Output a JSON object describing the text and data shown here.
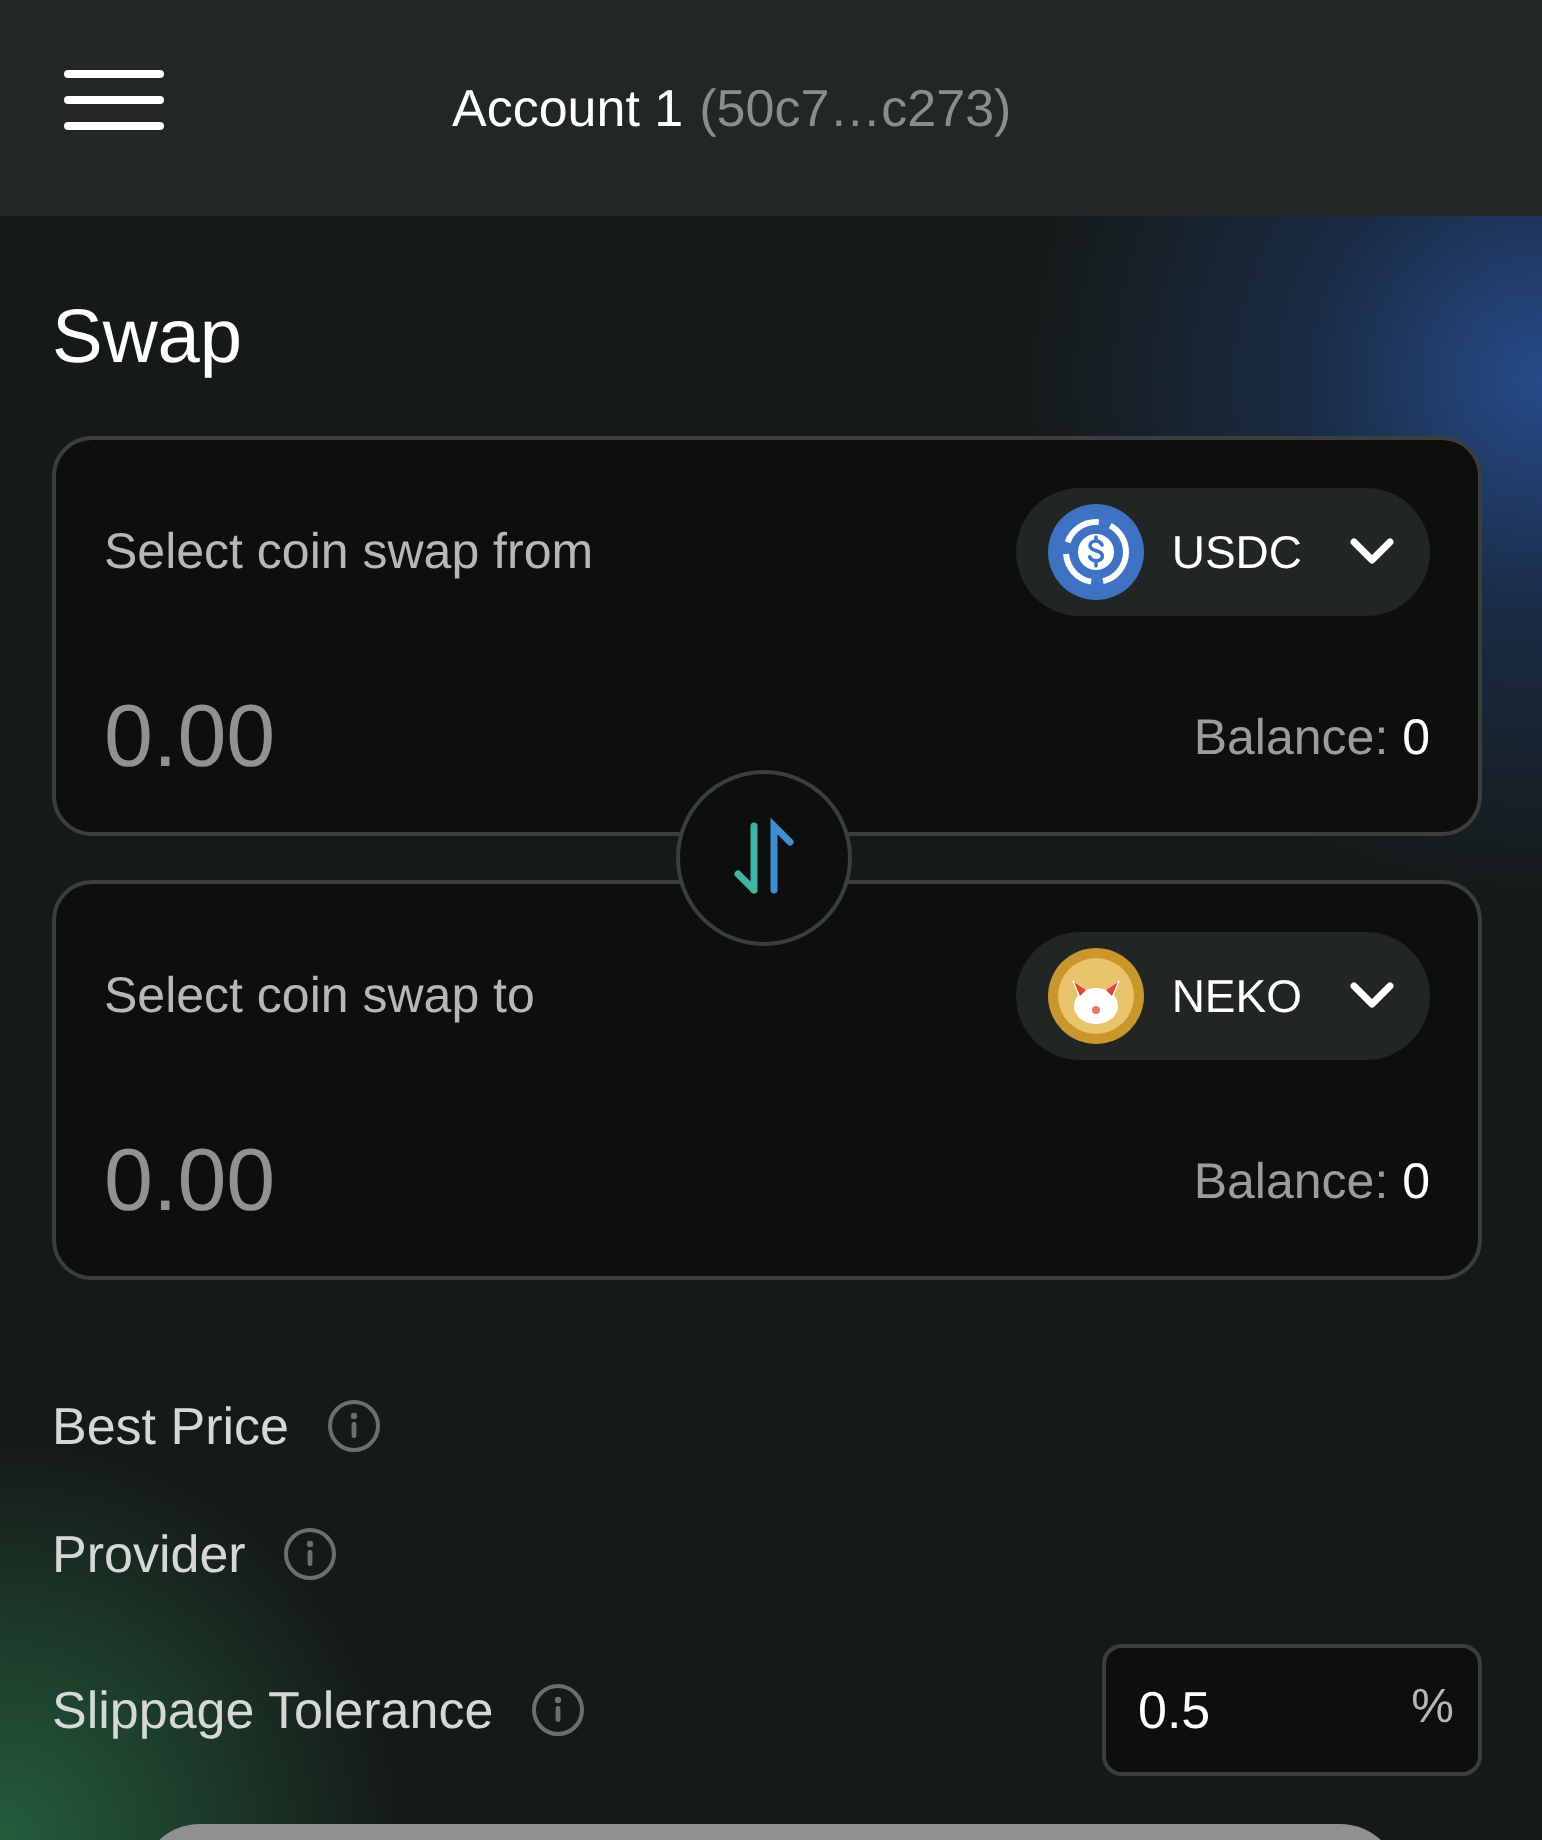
{
  "header": {
    "account": "Account 1",
    "address": "(50c7…c273)"
  },
  "title": "Swap",
  "swap_cards": [
    {
      "label": "Select coin swap from",
      "kind": "usdc",
      "token": "USDC",
      "placeholder": "0.00",
      "balance_label": "Balance:",
      "balance": "0"
    },
    {
      "label": "Select coin swap to",
      "kind": "neko",
      "token": "NEKO",
      "placeholder": "0.00",
      "balance_label": "Balance:",
      "balance": "0"
    }
  ],
  "details": [
    {
      "label": "Best Price"
    },
    {
      "label": "Provider"
    }
  ],
  "slippage": {
    "label": "Slippage Tolerance",
    "value": "0.5",
    "unit": "%"
  }
}
